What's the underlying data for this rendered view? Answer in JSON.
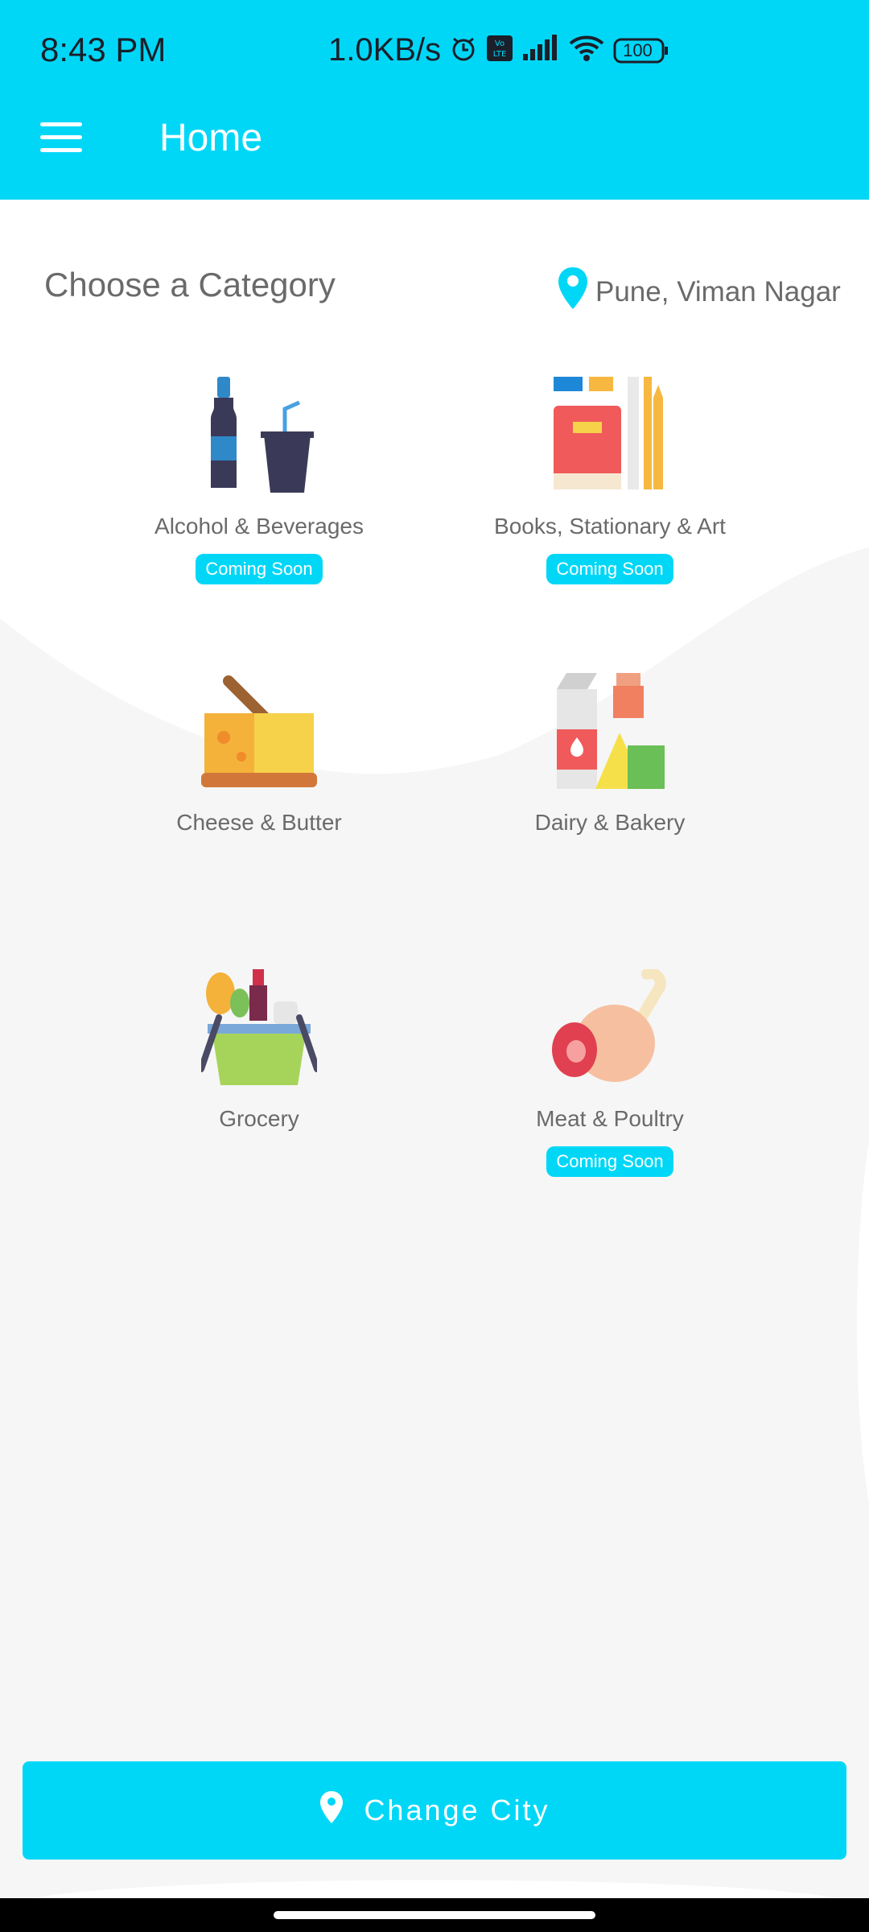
{
  "status_bar": {
    "time": "8:43 PM",
    "net_speed": "1.0KB/s",
    "battery": "100",
    "icons": [
      "alarm-icon",
      "volte-icon",
      "signal-icon",
      "wifi-icon",
      "battery-icon"
    ]
  },
  "app_bar": {
    "title": "Home",
    "menu_icon": "hamburger-menu-icon"
  },
  "main": {
    "heading": "Choose a Category",
    "location": "Pune, Viman Nagar",
    "categories": [
      {
        "label": "Alcohol & Beverages",
        "badge": "Coming Soon",
        "icon": "beverages-icon"
      },
      {
        "label": "Books, Stationary & Art",
        "badge": "Coming Soon",
        "icon": "books-icon"
      },
      {
        "label": "Cheese & Butter",
        "badge": "",
        "icon": "cheese-icon"
      },
      {
        "label": "Dairy & Bakery",
        "badge": "",
        "icon": "dairy-icon"
      },
      {
        "label": "Grocery",
        "badge": "",
        "icon": "grocery-basket-icon"
      },
      {
        "label": "Meat & Poultry",
        "badge": "Coming Soon",
        "icon": "meat-icon"
      }
    ]
  },
  "footer": {
    "button_label": "Change City",
    "button_icon": "location-pin-icon"
  },
  "colors": {
    "accent": "#00d7f7",
    "background": "#f6f6f6",
    "text": "#6a6a6a"
  }
}
